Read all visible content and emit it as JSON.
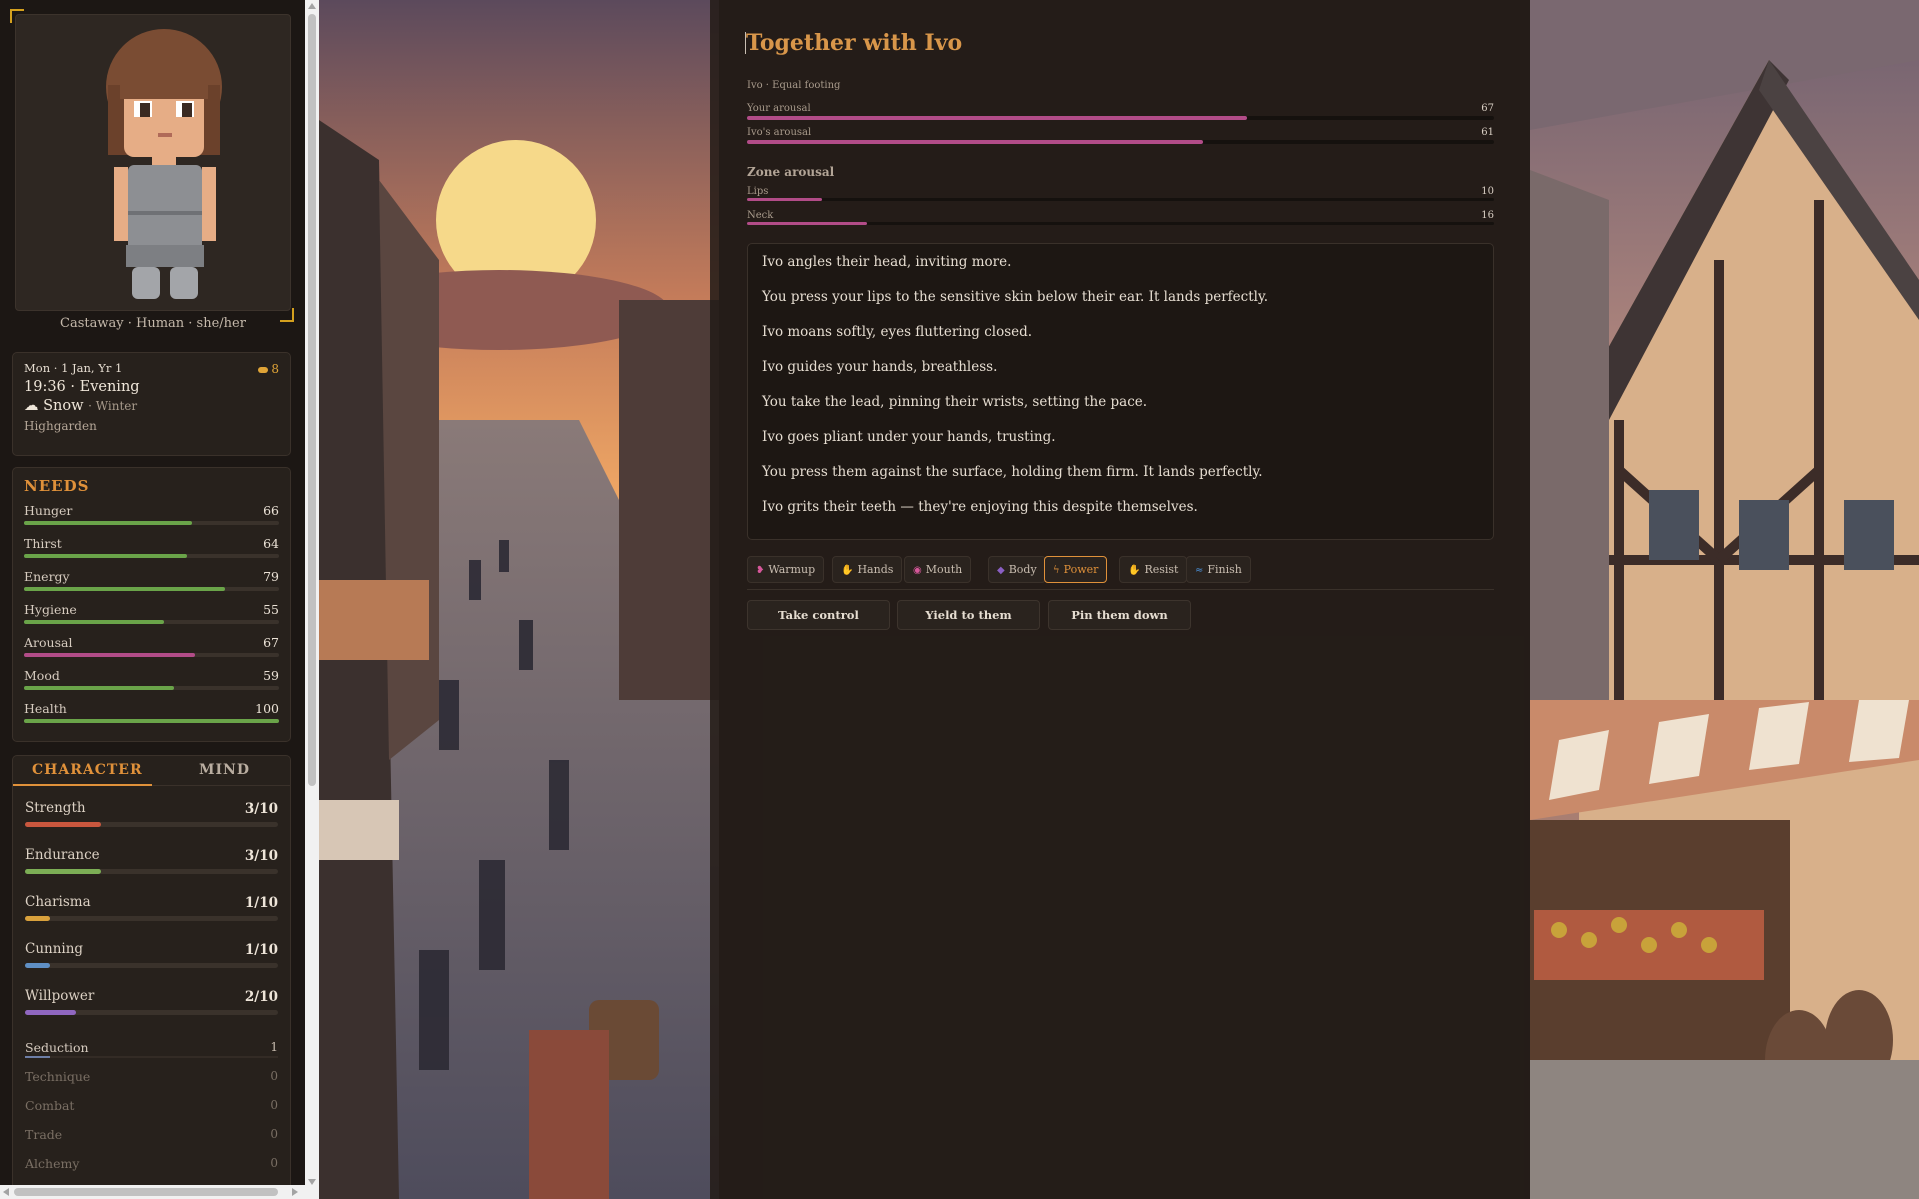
{
  "sidebar": {
    "identity": "Castaway · Human · she/her",
    "clock": {
      "date": "Mon · 1 Jan, Yr 1",
      "coins": "8",
      "time": "19:36 · Evening",
      "weather_icon": "snow-cloud-icon",
      "weather": "Snow",
      "season": "· Winter",
      "location": "Highgarden"
    },
    "needs": {
      "title": "NEEDS",
      "items": [
        {
          "label": "Hunger",
          "value": 66
        },
        {
          "label": "Thirst",
          "value": 64
        },
        {
          "label": "Energy",
          "value": 79
        },
        {
          "label": "Hygiene",
          "value": 55
        },
        {
          "label": "Arousal",
          "value": 67
        },
        {
          "label": "Mood",
          "value": 59
        },
        {
          "label": "Health",
          "value": 100
        }
      ]
    },
    "tabs": {
      "character": "CHARACTER",
      "mind": "MIND",
      "active": "character"
    },
    "stats": [
      {
        "label": "Strength",
        "value": "3/10",
        "level": 0.3,
        "color": "#c9573e"
      },
      {
        "label": "Endurance",
        "value": "3/10",
        "level": 0.3,
        "color": "#7cae55"
      },
      {
        "label": "Charisma",
        "value": "1/10",
        "level": 0.1,
        "color": "#d9a13c"
      },
      {
        "label": "Cunning",
        "value": "1/10",
        "level": 0.1,
        "color": "#5f8fc4"
      },
      {
        "label": "Willpower",
        "value": "2/10",
        "level": 0.2,
        "color": "#9067c0"
      }
    ],
    "skills": [
      {
        "label": "Seduction",
        "value": "1"
      },
      {
        "label": "Technique",
        "value": "0"
      },
      {
        "label": "Combat",
        "value": "0"
      },
      {
        "label": "Trade",
        "value": "0"
      },
      {
        "label": "Alchemy",
        "value": "0"
      }
    ]
  },
  "encounter": {
    "title": "Together with Ivo",
    "subtitle": "Ivo · Equal footing",
    "your_arousal": {
      "label": "Your arousal",
      "value": 67
    },
    "partner_arousal": {
      "label": "Ivo's arousal",
      "value": 61
    },
    "zone_title": "Zone arousal",
    "zones": [
      {
        "label": "Lips",
        "value": 10
      },
      {
        "label": "Neck",
        "value": 16
      }
    ],
    "log": [
      "Ivo angles their head, inviting more.",
      "You press your lips to the sensitive skin below their ear. It lands perfectly.",
      "Ivo moans softly, eyes fluttering closed.",
      "Ivo guides your hands, breathless.",
      "You take the lead, pinning their wrists, setting the pace.",
      "Ivo goes pliant under your hands, trusting.",
      "You press them against the surface, holding them firm. It lands perfectly.",
      "Ivo grits their teeth — they're enjoying this despite themselves."
    ],
    "action_tabs": [
      {
        "label": "Warmup",
        "icon": "kiss-icon",
        "glyph": "❥",
        "color": "#d6579a"
      },
      {
        "label": "Hands",
        "icon": "hand-icon",
        "glyph": "✋",
        "color": "#e8b640"
      },
      {
        "label": "Mouth",
        "icon": "lips-icon",
        "glyph": "◉",
        "color": "#d6579a"
      },
      {
        "label": "Body",
        "icon": "body-icon",
        "glyph": "◆",
        "color": "#8a5fc4"
      },
      {
        "label": "Power",
        "icon": "lightning-icon",
        "glyph": "ϟ",
        "color": "#e0913a"
      },
      {
        "label": "Resist",
        "icon": "palm-icon",
        "glyph": "✋",
        "color": "#e8b640"
      },
      {
        "label": "Finish",
        "icon": "wave-icon",
        "glyph": "≈",
        "color": "#4a8fd6"
      }
    ],
    "active_action": "Power",
    "choices": [
      "Take control",
      "Yield to them",
      "Pin them down"
    ]
  }
}
